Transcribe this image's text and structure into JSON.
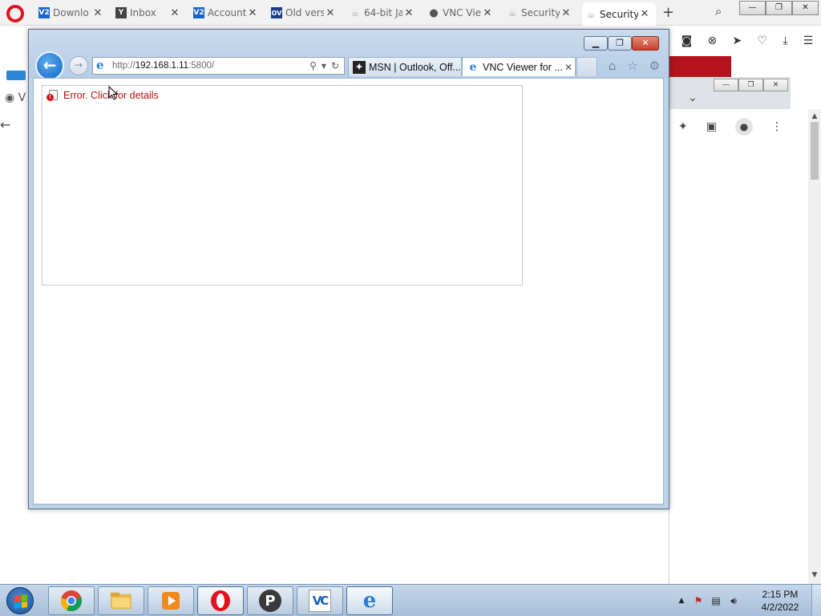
{
  "opera": {
    "tabs": [
      {
        "title": "Downlo",
        "icon": "vc-icon",
        "icon_text": "V2",
        "icon_color": "#1a64c8"
      },
      {
        "title": "Inbox",
        "icon": "yahoo-icon",
        "icon_text": "Y",
        "icon_color": "#444444"
      },
      {
        "title": "Account",
        "icon": "vc-icon",
        "icon_text": "V2",
        "icon_color": "#1a64c8"
      },
      {
        "title": "Old vers",
        "icon": "oldversion-icon",
        "icon_text": "OV",
        "icon_color": "#1b3f8c"
      },
      {
        "title": "64-bit Ja",
        "icon": "java-icon",
        "icon_text": "☕",
        "icon_color": "#b0b0b0"
      },
      {
        "title": "VNC Vie",
        "icon": "globe-icon",
        "icon_text": "●",
        "icon_color": "#555555"
      },
      {
        "title": "Security",
        "icon": "java-icon",
        "icon_text": "☕",
        "icon_color": "#b0b0b0"
      },
      {
        "title": "Security",
        "icon": "java-icon",
        "icon_text": "☕",
        "icon_color": "#b0b0b0",
        "active": true
      }
    ],
    "partial_label": "V"
  },
  "ie": {
    "url_prefix": "http://",
    "url_host": "192.168.1.11",
    "url_suffix": ":5800/",
    "tabs": [
      {
        "title": "MSN | Outlook, Off...",
        "icon": "msn-icon"
      },
      {
        "title": "VNC Viewer for ...",
        "icon": "ie-icon",
        "active": true
      }
    ],
    "error_text": "Error. Click for details"
  },
  "taskbar": {
    "apps": [
      "chrome-icon",
      "explorer-icon",
      "media-player-icon",
      "opera-icon",
      "psiphon-icon",
      "vnc-icon",
      "internet-explorer-icon"
    ],
    "psiphon_letter": "P",
    "vnc_letters": "VC",
    "ie_letter": "e",
    "time": "2:15 PM",
    "date": "4/2/2022"
  },
  "colors": {
    "opera_red": "#e0121f",
    "ie_frame": "#bcd3ea",
    "error_red": "#b01010",
    "taskbar": "#b6cbe2"
  }
}
